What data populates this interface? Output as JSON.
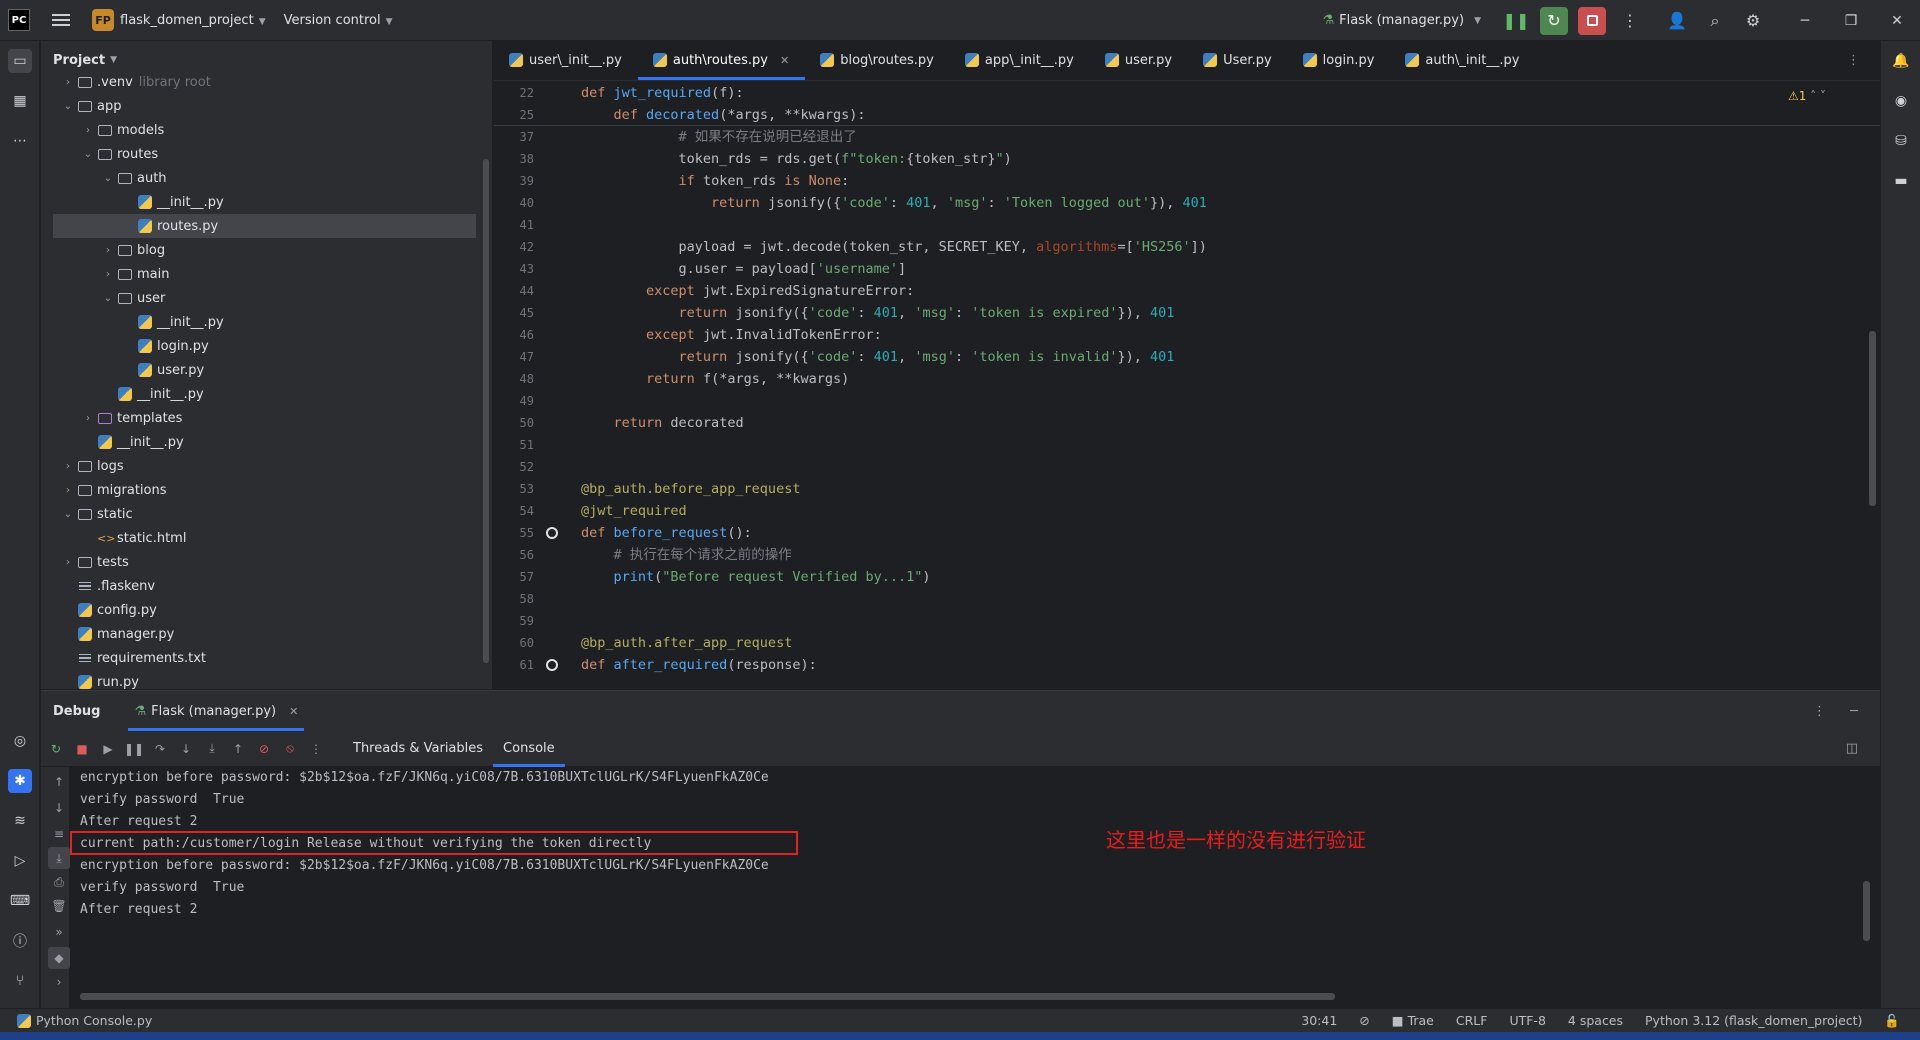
{
  "titlebar": {
    "app_logo": "PC",
    "project_badge": "FP",
    "project_name": "flask_domen_project",
    "version_control": "Version control",
    "run_config": "Flask (manager.py)"
  },
  "project_panel": {
    "title": "Project",
    "tree": [
      {
        "label": ".venv",
        "extra": "library root",
        "type": "folder",
        "depth": 1,
        "state": "closed"
      },
      {
        "label": "app",
        "type": "folder",
        "depth": 1,
        "state": "open"
      },
      {
        "label": "models",
        "type": "folder",
        "depth": 2,
        "state": "closed"
      },
      {
        "label": "routes",
        "type": "folder",
        "depth": 2,
        "state": "open"
      },
      {
        "label": "auth",
        "type": "folder",
        "depth": 3,
        "state": "open"
      },
      {
        "label": "__init__.py",
        "type": "py",
        "depth": 4
      },
      {
        "label": "routes.py",
        "type": "py",
        "depth": 4,
        "selected": true
      },
      {
        "label": "blog",
        "type": "folder",
        "depth": 3,
        "state": "closed"
      },
      {
        "label": "main",
        "type": "folder",
        "depth": 3,
        "state": "closed"
      },
      {
        "label": "user",
        "type": "folder",
        "depth": 3,
        "state": "open"
      },
      {
        "label": "__init__.py",
        "type": "py",
        "depth": 4
      },
      {
        "label": "login.py",
        "type": "py",
        "depth": 4
      },
      {
        "label": "user.py",
        "type": "py",
        "depth": 4
      },
      {
        "label": "__init__.py",
        "type": "py",
        "depth": 3
      },
      {
        "label": "templates",
        "type": "folder-purple",
        "depth": 2,
        "state": "closed"
      },
      {
        "label": "__init__.py",
        "type": "py",
        "depth": 2
      },
      {
        "label": "logs",
        "type": "folder",
        "depth": 1,
        "state": "closed"
      },
      {
        "label": "migrations",
        "type": "folder",
        "depth": 1,
        "state": "closed"
      },
      {
        "label": "static",
        "type": "folder",
        "depth": 1,
        "state": "open"
      },
      {
        "label": "static.html",
        "type": "html",
        "depth": 2
      },
      {
        "label": "tests",
        "type": "folder",
        "depth": 1,
        "state": "closed"
      },
      {
        "label": ".flaskenv",
        "type": "text",
        "depth": 1
      },
      {
        "label": "config.py",
        "type": "py",
        "depth": 1
      },
      {
        "label": "manager.py",
        "type": "py",
        "depth": 1
      },
      {
        "label": "requirements.txt",
        "type": "text",
        "depth": 1
      },
      {
        "label": "run.py",
        "type": "py",
        "depth": 1
      }
    ]
  },
  "editor": {
    "tabs": [
      {
        "label": "user\\_init__.py",
        "active": false
      },
      {
        "label": "auth\\routes.py",
        "active": true,
        "closable": true
      },
      {
        "label": "blog\\routes.py",
        "active": false
      },
      {
        "label": "app\\_init__.py",
        "active": false
      },
      {
        "label": "user.py",
        "active": false
      },
      {
        "label": "User.py",
        "active": false
      },
      {
        "label": "login.py",
        "active": false
      },
      {
        "label": "auth\\_init__.py",
        "active": false
      }
    ],
    "warning_count": "1",
    "sticky_lines": [
      {
        "n": "22",
        "html": "<span class=\"kw\">def </span><span class=\"fn\">jwt_required</span>(f):"
      },
      {
        "n": "25",
        "html": "    <span class=\"kw\">def </span><span class=\"fn\">decorated</span>(*args, **kwargs):"
      }
    ],
    "lines": [
      {
        "n": "37",
        "html": "            <span class=\"cmt\"># 如果不存在说明已经退出了</span>"
      },
      {
        "n": "38",
        "html": "            token_rds = rds.get(<span class=\"str\">f\"token:</span>{token_str}<span class=\"str\">\"</span>)"
      },
      {
        "n": "39",
        "html": "            <span class=\"kw\">if </span>token_rds <span class=\"kw\">is None</span>:"
      },
      {
        "n": "40",
        "html": "                <span class=\"kw\">return </span>jsonify({<span class=\"str\">'code'</span>: <span class=\"num\">401</span>, <span class=\"str\">'msg'</span>: <span class=\"str\">'Token logged out'</span>}), <span class=\"num\">401</span>"
      },
      {
        "n": "41",
        "html": ""
      },
      {
        "n": "42",
        "html": "            payload = jwt.decode(token_str, SECRET_KEY, <span class=\"param\">algorithms</span>=[<span class=\"str\">'HS256'</span>])"
      },
      {
        "n": "43",
        "html": "            g.user = payload[<span class=\"str\">'username'</span>]"
      },
      {
        "n": "44",
        "html": "        <span class=\"kw\">except </span>jwt.ExpiredSignatureError:"
      },
      {
        "n": "45",
        "html": "            <span class=\"kw\">return </span>jsonify({<span class=\"str\">'code'</span>: <span class=\"num\">401</span>, <span class=\"str\">'msg'</span>: <span class=\"str\">'token is expired'</span>}), <span class=\"num\">401</span>"
      },
      {
        "n": "46",
        "html": "        <span class=\"kw\">except </span>jwt.InvalidTokenError:"
      },
      {
        "n": "47",
        "html": "            <span class=\"kw\">return </span>jsonify({<span class=\"str\">'code'</span>: <span class=\"num\">401</span>, <span class=\"str\">'msg'</span>: <span class=\"str\">'token is invalid'</span>}), <span class=\"num\">401</span>"
      },
      {
        "n": "48",
        "html": "        <span class=\"kw\">return </span>f(*args, **kwargs)"
      },
      {
        "n": "49",
        "html": ""
      },
      {
        "n": "50",
        "html": "    <span class=\"kw\">return </span>decorated"
      },
      {
        "n": "51",
        "html": ""
      },
      {
        "n": "52",
        "html": ""
      },
      {
        "n": "53",
        "html": "<span class=\"deco\">@bp_auth.before_app_request</span>"
      },
      {
        "n": "54",
        "html": "<span class=\"deco\">@jwt_required</span>"
      },
      {
        "n": "55",
        "html": "<span class=\"kw\">def </span><span class=\"fn\">before_request</span>():",
        "breakpoint": true
      },
      {
        "n": "56",
        "html": "    <span class=\"cmt\"># 执行在每个请求之前的操作</span>"
      },
      {
        "n": "57",
        "html": "    <span class=\"fn\">print</span>(<span class=\"str\">\"Before request Verified by...1\"</span>)"
      },
      {
        "n": "58",
        "html": ""
      },
      {
        "n": "59",
        "html": ""
      },
      {
        "n": "60",
        "html": "<span class=\"deco\">@bp_auth.after_app_request</span>"
      },
      {
        "n": "61",
        "html": "<span class=\"kw\">def </span><span class=\"fn\">after_required</span>(response):",
        "breakpoint": true
      }
    ]
  },
  "debug": {
    "title": "Debug",
    "session_tab": "Flask (manager.py)",
    "subtabs": [
      "Threads & Variables",
      "Console"
    ],
    "console_lines": [
      "encryption before password: $2b$12$oa.fzF/JKN6q.yiC08/7B.6310BUXTclUGLrK/S4FLyuenFkAZ0Ce",
      "verify password  True",
      "After request 2",
      "current path:/customer/login Release without verifying the token directly",
      "encryption before password: $2b$12$oa.fzF/JKN6q.yiC08/7B.6310BUXTclUGLrK/S4FLyuenFkAZ0Ce",
      "verify password  True",
      "After request 2"
    ],
    "annotation": "这里也是一样的没有进行验证",
    "annotation_color": "#e81c1c"
  },
  "statusbar": {
    "left": "Python Console.py",
    "position": "30:41",
    "tool": "Trae",
    "line_sep": "CRLF",
    "encoding": "UTF-8",
    "indent": "4 spaces",
    "interpreter": "Python 3.12 (flask_domen_project)"
  },
  "colors": {
    "accent": "#3574f0",
    "background": "#1e1f22",
    "panel": "#2b2d30"
  }
}
